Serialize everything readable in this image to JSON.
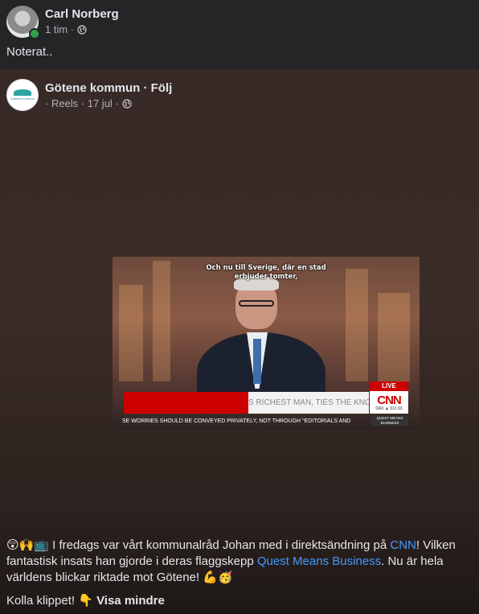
{
  "post": {
    "author": "Carl Norberg",
    "time": "1 tim ·",
    "privacy_icon": "globe-icon",
    "text": "Noterat.."
  },
  "shared": {
    "author": "Götene kommun · Följ",
    "meta": "· Reels · 17 jul ·",
    "privacy_icon": "globe-icon",
    "logo_text": "Götene kommun",
    "video": {
      "subtitle_line1": "Och nu till Sverige, där en stad",
      "subtitle_line2": "erbjuder tomter,",
      "live": "LIVE",
      "ticker": "S RICHEST MAN, TIES THE KNOT",
      "network": "CNN",
      "dax": "DAX ▲ 313.93",
      "crawl": "SE WORRIES SHOULD BE CONVEYED PRIVATELY, NOT THROUGH \"EDITORIALS AND",
      "show_badge": "QUEST MEANS BUSINESS"
    },
    "caption": {
      "emojis_start": "😲🙌📺",
      "part1": " I fredags var vårt kommunalråd Johan med i direktsändning på ",
      "link1": "CNN",
      "part2": "! Vilken fantastisk insats han gjorde i deras flaggskepp ",
      "link2": "Quest Means Business",
      "part3": ". Nu är hela världens blickar riktade mot Götene! ",
      "emojis_end": "💪🥳",
      "line2": "Kolla klippet! 👇 ",
      "see_less": "Visa mindre"
    }
  },
  "colors": {
    "background": "#242526",
    "text": "#e4e6eb",
    "secondary": "#b0b3b8",
    "link": "#4599ff",
    "online": "#31a24c",
    "cnn_red": "#cc0000"
  }
}
